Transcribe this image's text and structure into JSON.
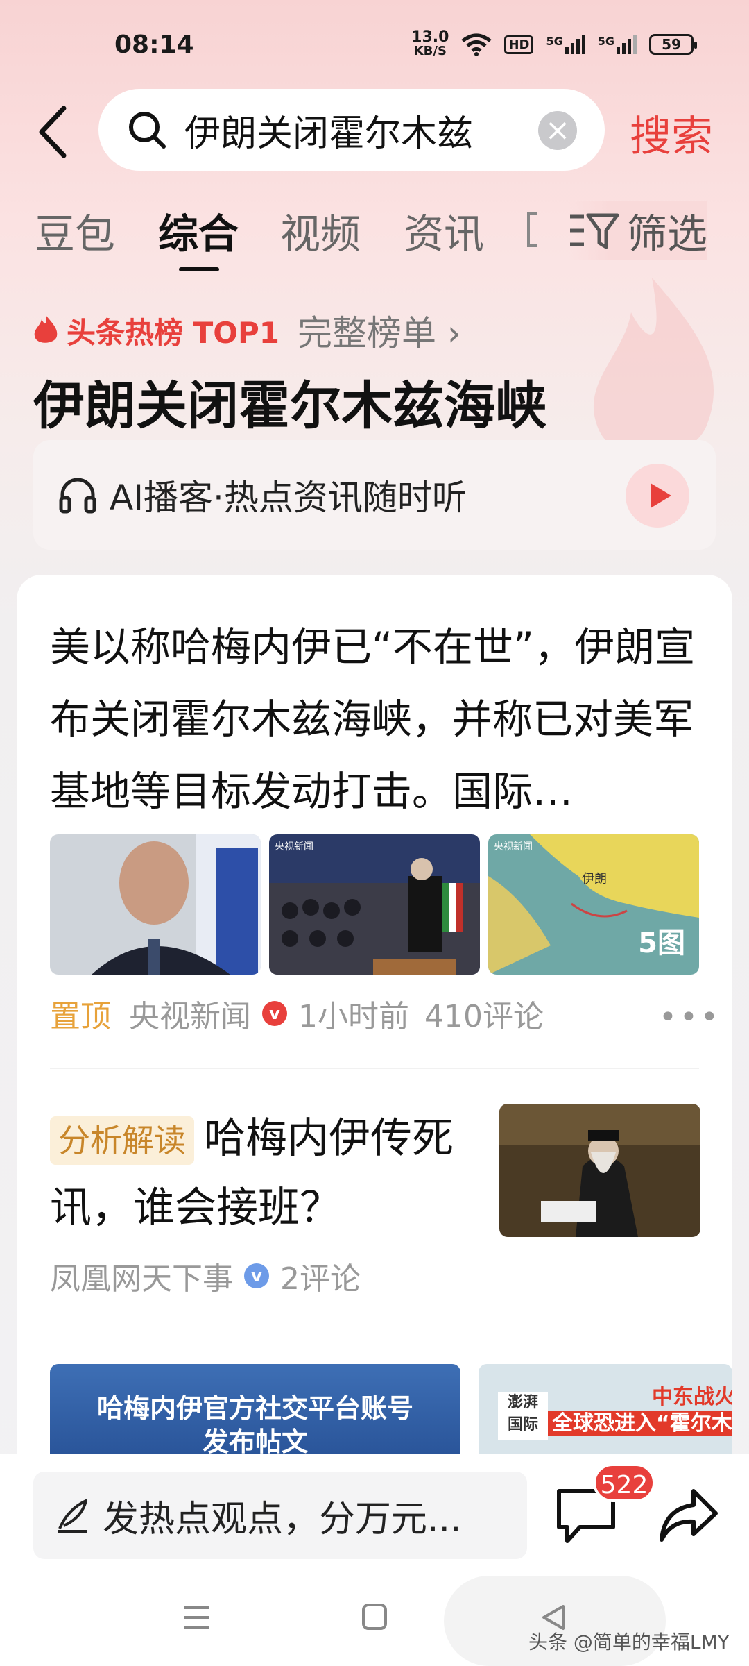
{
  "status": {
    "time": "08:14",
    "speed_value": "13.0",
    "speed_unit": "KB/S",
    "hd": "HD",
    "net1": "5G",
    "net2": "5G",
    "battery": "59"
  },
  "search": {
    "query": "伊朗关闭霍尔木兹",
    "button": "搜索"
  },
  "tabs": [
    {
      "label": "豆包",
      "active": false
    },
    {
      "label": "综合",
      "active": true
    },
    {
      "label": "视频",
      "active": false
    },
    {
      "label": "资讯",
      "active": false
    }
  ],
  "filter": {
    "label": "筛选"
  },
  "hot": {
    "label": "头条热榜 TOP1",
    "full_list": "完整榜单 ›",
    "title": "伊朗关闭霍尔木兹海峡"
  },
  "ai_podcast": {
    "label": "AI播客·热点资讯随时听"
  },
  "article1": {
    "headline": "美以称哈梅内伊已“不在世”，伊朗宣布关闭霍尔木兹海峡，并称已对美军基地等目标发动打击。国际…",
    "image_count": "5图",
    "pin": "置顶",
    "source": "央视新闻",
    "time": "1小时前",
    "comments": "410评论",
    "img2_logo": "央视新闻",
    "img3_logo": "央视新闻",
    "img3_map_label": "伊朗"
  },
  "article2": {
    "tag": "分析解读",
    "title": "哈梅内伊传死讯，谁会接班？",
    "source": "凤凰网天下事",
    "comments": "2评论"
  },
  "video1": {
    "line1": "哈梅内伊官方社交平台账号",
    "line2": "发布帖文"
  },
  "video2": {
    "logo1": "澎湃",
    "logo2": "国际",
    "line1": "中东战火再燃",
    "line2": "全球恐进入“霍尔木"
  },
  "bottom": {
    "comment_placeholder": "发热点观点，分万元...",
    "comment_count": "522"
  },
  "watermark": "头条 @简单的幸福LMY",
  "colors": {
    "accent": "#e8403c",
    "pin": "#e7a23a",
    "tag_bg": "#fbefd9"
  }
}
